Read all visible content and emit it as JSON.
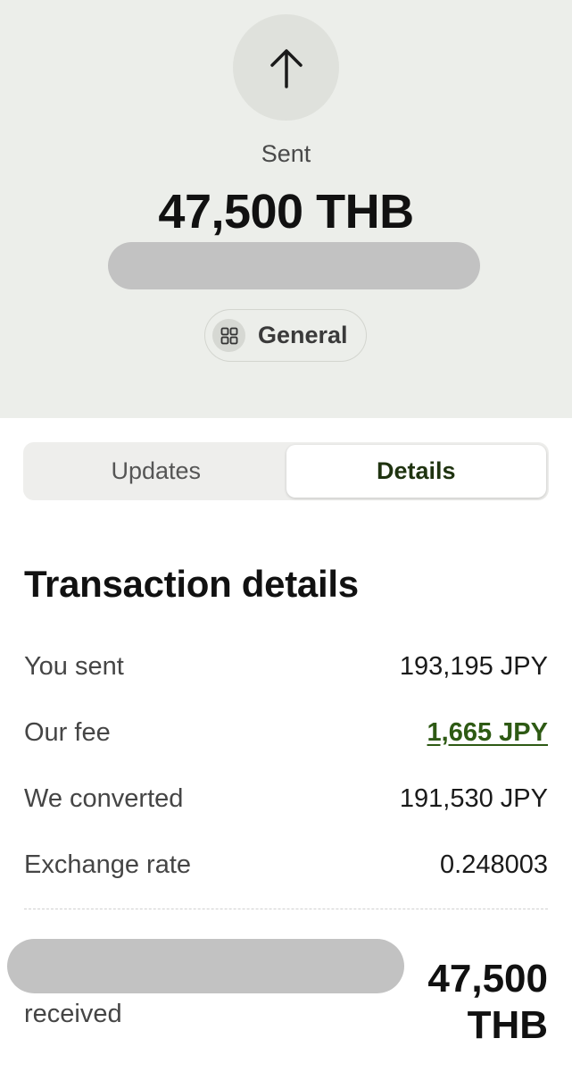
{
  "header": {
    "status": "Sent",
    "amount": "47,500 THB",
    "category": "General"
  },
  "tabs": [
    {
      "label": "Updates",
      "active": false
    },
    {
      "label": "Details",
      "active": true
    }
  ],
  "details": {
    "title": "Transaction details",
    "rows": [
      {
        "label": "You sent",
        "value": "193,195 JPY"
      },
      {
        "label": "Our fee",
        "value": "1,665 JPY"
      },
      {
        "label": "We converted",
        "value": "191,530 JPY"
      },
      {
        "label": "Exchange rate",
        "value": "0.248003"
      }
    ],
    "received_label": "received",
    "received_amount_line1": "47,500",
    "received_amount_line2": "THB"
  },
  "icons": {
    "status": "arrow-up-icon",
    "category": "grid-icon"
  },
  "colors": {
    "header_bg": "#eceeea",
    "accent_green": "#2e5a14",
    "redaction": "#c2c2c2"
  }
}
